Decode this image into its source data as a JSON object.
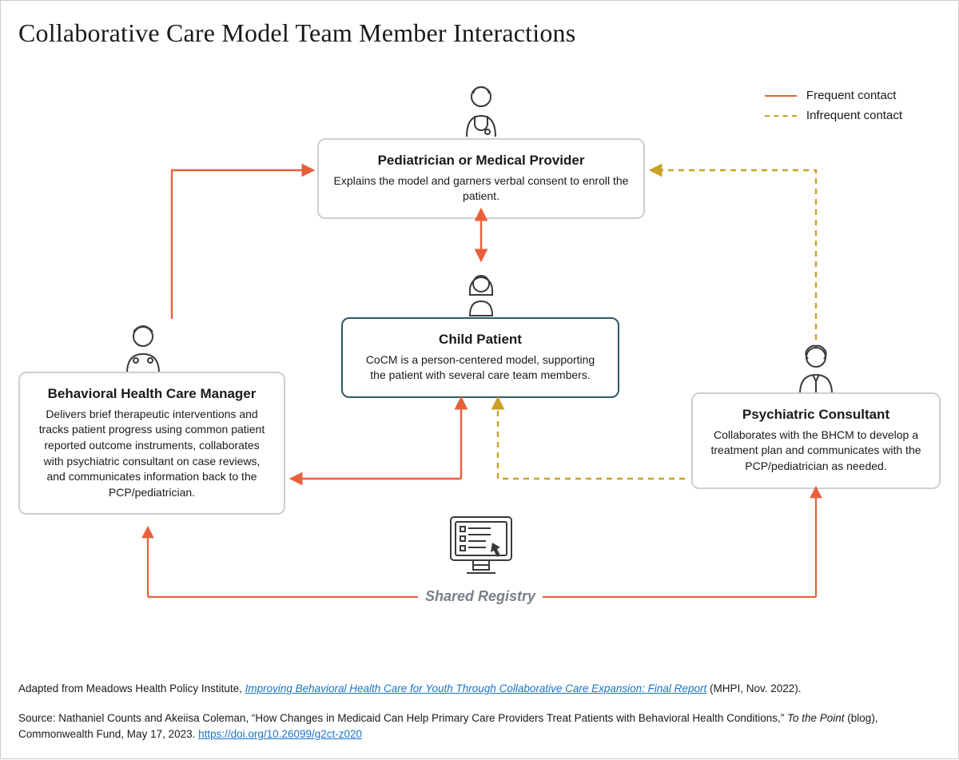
{
  "title": "Collaborative Care Model Team Member Interactions",
  "legend": {
    "frequent": "Frequent contact",
    "infrequent": "Infrequent contact"
  },
  "nodes": {
    "pediatrician": {
      "title": "Pediatrician or Medical Provider",
      "desc": "Explains the model and garners verbal consent to enroll the patient."
    },
    "bhcm": {
      "title": "Behavioral Health Care Manager",
      "desc": "Delivers brief therapeutic interventions and tracks patient progress using common patient reported outcome instruments, collaborates with psychiatric consultant on case reviews, and communicates information back to the PCP/pediatrician."
    },
    "child": {
      "title": "Child Patient",
      "desc": "CoCM is a person-centered model, supporting the patient with several care team members."
    },
    "psych": {
      "title": "Psychiatric Consultant",
      "desc": "Collaborates with the BHCM to develop a treatment plan and communicates with the PCP/pediatrician as needed."
    },
    "registry": {
      "label": "Shared Registry"
    }
  },
  "footer": {
    "adapted_prefix": "Adapted from Meadows Health Policy Institute, ",
    "adapted_link": "Improving Behavioral Health Care for Youth Through Collaborative Care Expansion: Final Report",
    "adapted_suffix": " (MHPI, Nov. 2022).",
    "source_prefix": "Source: Nathaniel Counts and Akeiisa Coleman, “How Changes in Medicaid Can Help Primary Care Providers Treat Patients with Behavioral Health Conditions,” ",
    "source_pub": "To the Point",
    "source_mid": " (blog), Commonwealth Fund, May 17, 2023. ",
    "source_url": "https://doi.org/10.26099/g2ct-z020"
  },
  "colors": {
    "frequent": "#e7603c",
    "infrequent": "#c9a227",
    "node_border": "#c9d1d6",
    "center_border": "#2f5a64"
  }
}
